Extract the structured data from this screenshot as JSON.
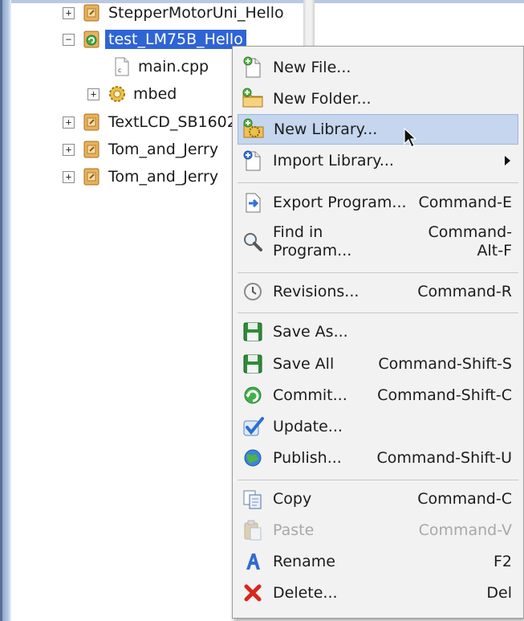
{
  "tree": {
    "items": [
      {
        "label": "StepperMotorUni_Hello",
        "expander": "+",
        "icon": "program-folder-icon"
      },
      {
        "label": "test_LM75B_Hello",
        "expander": "−",
        "icon": "program-active-icon"
      },
      {
        "label": "main.cpp",
        "icon": "file-icon"
      },
      {
        "label": "mbed",
        "expander": "+",
        "icon": "gear-library-icon"
      },
      {
        "label": "TextLCD_SB1602",
        "expander": "+",
        "icon": "program-folder-icon"
      },
      {
        "label": "Tom_and_Jerry",
        "expander": "+",
        "icon": "program-folder-icon"
      },
      {
        "label": "Tom_and_Jerry",
        "expander": "+",
        "icon": "program-folder-icon"
      }
    ]
  },
  "menu": {
    "items": [
      {
        "label": "New File...",
        "shortcut": "",
        "icon": "new-file-icon"
      },
      {
        "label": "New Folder...",
        "shortcut": "",
        "icon": "new-folder-icon"
      },
      {
        "label": "New Library...",
        "shortcut": "",
        "icon": "new-library-icon"
      },
      {
        "label": "Import Library...",
        "shortcut": "",
        "icon": "import-library-icon"
      },
      {
        "label": "Export Program...",
        "shortcut": "Command-E",
        "icon": "export-icon"
      },
      {
        "label": "Find in\nProgram...",
        "shortcut": "Command-\nAlt-F",
        "icon": "magnifier-icon"
      },
      {
        "label": "Revisions...",
        "shortcut": "Command-R",
        "icon": "clock-icon"
      },
      {
        "label": "Save As...",
        "shortcut": "",
        "icon": "save-as-icon"
      },
      {
        "label": "Save All",
        "shortcut": "Command-Shift-S",
        "icon": "save-all-icon"
      },
      {
        "label": "Commit...",
        "shortcut": "Command-Shift-C",
        "icon": "commit-icon"
      },
      {
        "label": "Update...",
        "shortcut": "",
        "icon": "update-check-icon"
      },
      {
        "label": "Publish...",
        "shortcut": "Command-Shift-U",
        "icon": "publish-globe-icon"
      },
      {
        "label": "Copy",
        "shortcut": "Command-C",
        "icon": "copy-icon"
      },
      {
        "label": "Paste",
        "shortcut": "Command-V",
        "icon": "paste-icon"
      },
      {
        "label": "Rename",
        "shortcut": "F2",
        "icon": "rename-icon"
      },
      {
        "label": "Delete...",
        "shortcut": "Del",
        "icon": "delete-icon"
      }
    ]
  },
  "colors": {
    "selection": "#2f64d4",
    "menu_background": "#f2f2f2",
    "menu_hover": "#c5d6ee",
    "disabled_text": "#a8a8a8"
  }
}
